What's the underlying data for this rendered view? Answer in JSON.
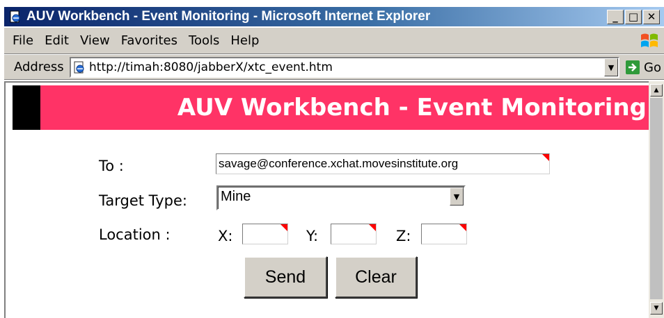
{
  "window": {
    "title": "AUV Workbench - Event Monitoring - Microsoft Internet Explorer",
    "buttons": {
      "minimize": "_",
      "maximize": "□",
      "close": "✕"
    }
  },
  "menu": {
    "items": [
      "File",
      "Edit",
      "View",
      "Favorites",
      "Tools",
      "Help"
    ]
  },
  "address": {
    "label": "Address",
    "url": "http://timah:8080/jabberX/xtc_event.htm",
    "go_label": "Go"
  },
  "page": {
    "banner_title": "AUV Workbench - Event Monitoring",
    "banner_color": "#ff3366",
    "form": {
      "to_label": "To :",
      "to_value": "savage@conference.xchat.movesinstitute.org",
      "target_type_label": "Target Type:",
      "target_type_value": "Mine",
      "location_label": "Location :",
      "x_label": "X:",
      "y_label": "Y:",
      "z_label": "Z:",
      "x_value": "",
      "y_value": "",
      "z_value": ""
    },
    "buttons": {
      "send": "Send",
      "clear": "Clear"
    }
  }
}
